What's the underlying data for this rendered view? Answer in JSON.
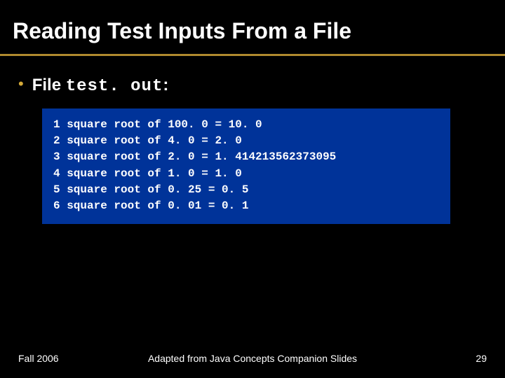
{
  "title": "Reading Test Inputs From a File",
  "bullet": {
    "prefix": "File ",
    "filename": "test. out",
    "suffix": ":"
  },
  "code_lines": [
    "1 square root of 100. 0 = 10. 0",
    "2 square root of 4. 0 = 2. 0",
    "3 square root of 2. 0 = 1. 414213562373095",
    "4 square root of 1. 0 = 1. 0",
    "5 square root of 0. 25 = 0. 5",
    "6 square root of 0. 01 = 0. 1"
  ],
  "footer": {
    "left": "Fall 2006",
    "center": "Adapted from Java Concepts Companion Slides",
    "page": "29"
  }
}
